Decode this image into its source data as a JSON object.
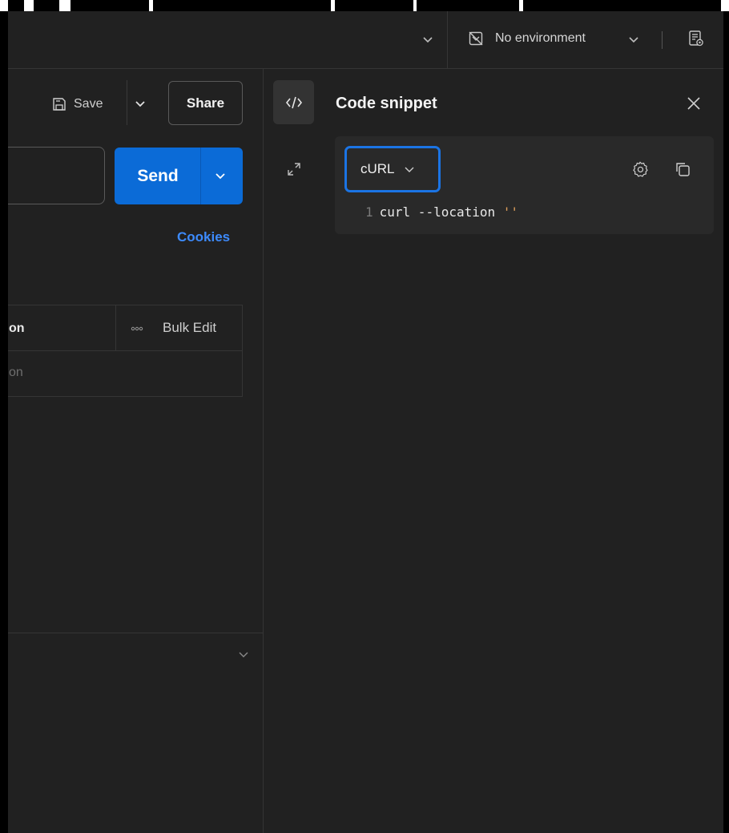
{
  "header": {
    "environment_label": "No environment"
  },
  "request": {
    "save_label": "Save",
    "share_label": "Share",
    "send_label": "Send",
    "cookies_label": "Cookies"
  },
  "params": {
    "column_description": "on",
    "bulk_edit_label": "Bulk Edit",
    "row_description_placeholder": "on"
  },
  "code_snippet": {
    "title": "Code snippet",
    "language": "cURL",
    "lines": [
      {
        "number": "1",
        "code": "curl --location ",
        "string": "''"
      }
    ]
  },
  "colors": {
    "accent": "#0b6bd7",
    "focus_ring": "#1b74e4",
    "link": "#3d8bfd",
    "background": "#212121"
  }
}
